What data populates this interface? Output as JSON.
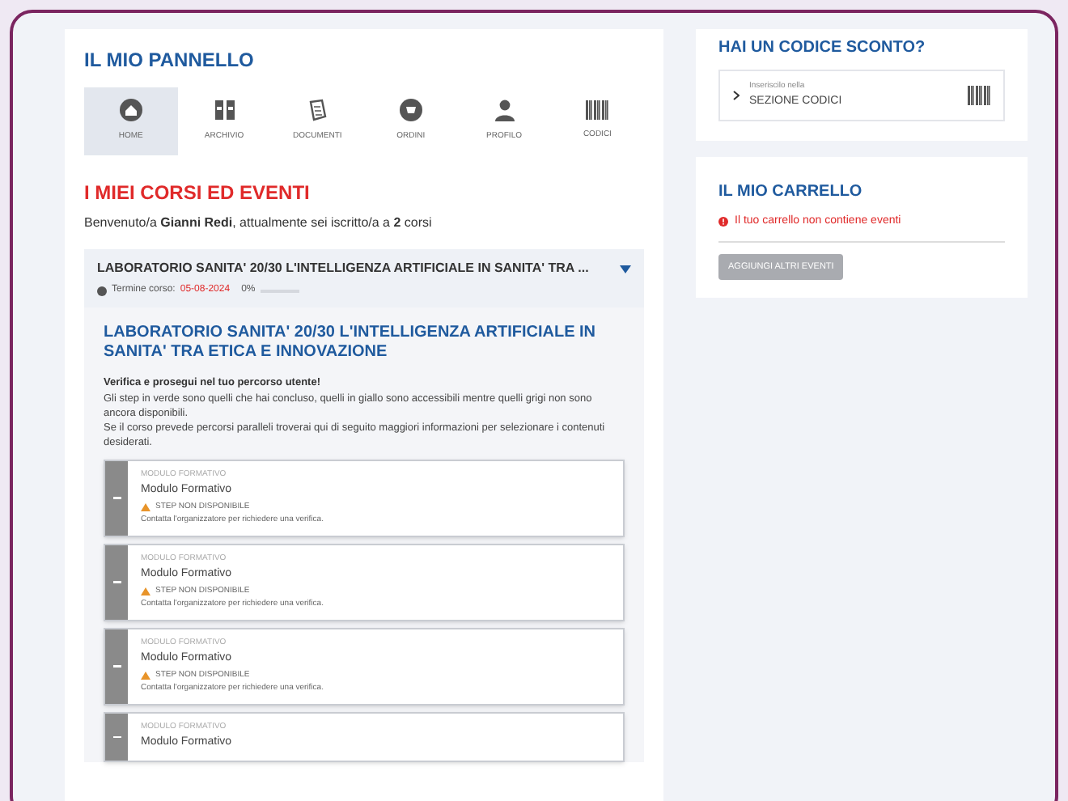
{
  "panel": {
    "title": "IL MIO PANNELLO",
    "tabs": [
      {
        "label": "HOME",
        "kind": "home",
        "selected": true
      },
      {
        "label": "ARCHIVIO",
        "kind": "archive",
        "selected": false
      },
      {
        "label": "DOCUMENTI",
        "kind": "document",
        "selected": false
      },
      {
        "label": "ORDINI",
        "kind": "cart",
        "selected": false
      },
      {
        "label": "PROFILO",
        "kind": "user",
        "selected": false
      },
      {
        "label": "CODICI",
        "kind": "barcode",
        "selected": false
      }
    ]
  },
  "courses": {
    "title": "I MIEI CORSI ED EVENTI",
    "welcome": "Benvenuto/a **Gianni Redi**, attualmente sei iscritto/a a **2** corsi",
    "course": {
      "header": "LABORATORIO SANITA' 20/30 L'INTELLIGENZA ARTIFICIALE IN SANITA' TRA ...",
      "expanded": true,
      "deadline_label": "Termine corso:",
      "deadline": "05-08-2024",
      "progress_text": "0%",
      "title": "LABORATORIO SANITA' 20/30 L'INTELLIGENZA ARTIFICIALE IN SANITA' TRA ETICA E INNOVAZIONE",
      "intro": "Verifica e prosegui nel tuo percorso utente!",
      "description": [
        "Gli step in verde sono quelli che hai concluso, quelli in giallo sono accessibili mentre quelli grigi non sono ancora disponibili.",
        "Se il corso prevede percorsi paralleli troverai qui di seguito maggiori informazioni per selezionare i contenuti desiderati."
      ],
      "modules": [
        {
          "label": "MODULO FORMATIVO",
          "title": "Modulo Formativo",
          "status": "STEP NON DISPONIBILE",
          "note": "Contatta l'organizzatore per richiedere una verifica."
        },
        {
          "label": "MODULO FORMATIVO",
          "title": "Modulo Formativo",
          "status": "STEP NON DISPONIBILE",
          "note": "Contatta l'organizzatore per richiedere una verifica."
        },
        {
          "label": "MODULO FORMATIVO",
          "title": "Modulo Formativo",
          "status": "STEP NON DISPONIBILE",
          "note": "Contatta l'organizzatore per richiedere una verifica."
        },
        {
          "label": "MODULO FORMATIVO",
          "title": "Modulo Formativo"
        }
      ]
    }
  },
  "discount": {
    "title": "HAI UN CODICE SCONTO?",
    "hint": "Inseriscilo nella",
    "link": "SEZIONE CODICI"
  },
  "cart": {
    "title": "IL MIO CARRELLO",
    "message": "Il tuo carrello non contiene eventi",
    "button": "AGGIUNGI ALTRI EVENTI"
  }
}
